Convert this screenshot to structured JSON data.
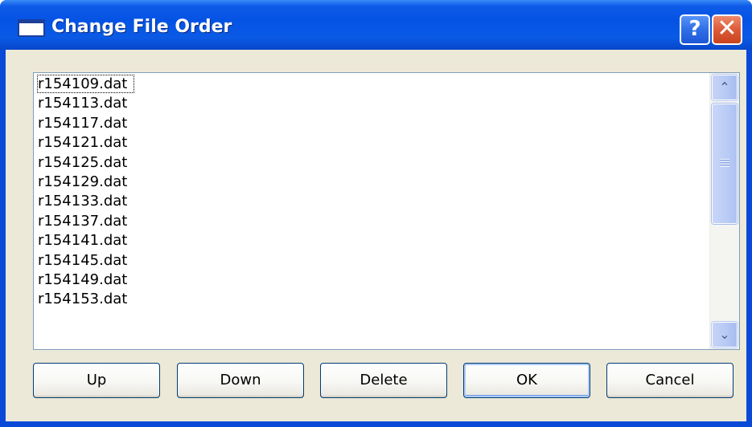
{
  "window": {
    "title": "Change File Order",
    "help_glyph": "?",
    "close_glyph": "✕"
  },
  "file_list": {
    "items": [
      "r154109.dat",
      "r154113.dat",
      "r154117.dat",
      "r154121.dat",
      "r154125.dat",
      "r154129.dat",
      "r154133.dat",
      "r154137.dat",
      "r154141.dat",
      "r154145.dat",
      "r154149.dat",
      "r154153.dat"
    ],
    "focused_index": 0,
    "scroll_up_glyph": "⌃",
    "scroll_down_glyph": "⌄"
  },
  "buttons": {
    "up": "Up",
    "down": "Down",
    "delete": "Delete",
    "ok": "OK",
    "cancel": "Cancel"
  },
  "icons": {
    "window": "window-icon",
    "help": "help-icon",
    "close": "close-icon",
    "scroll_up": "chevron-up-icon",
    "scroll_down": "chevron-down-icon",
    "grip": "scroll-grip-icon"
  },
  "colors": {
    "titlebar": "#0553e4",
    "client_bg": "#ece9d8",
    "close_button": "#dd5a38",
    "scrollbar": "#bccdf6"
  }
}
